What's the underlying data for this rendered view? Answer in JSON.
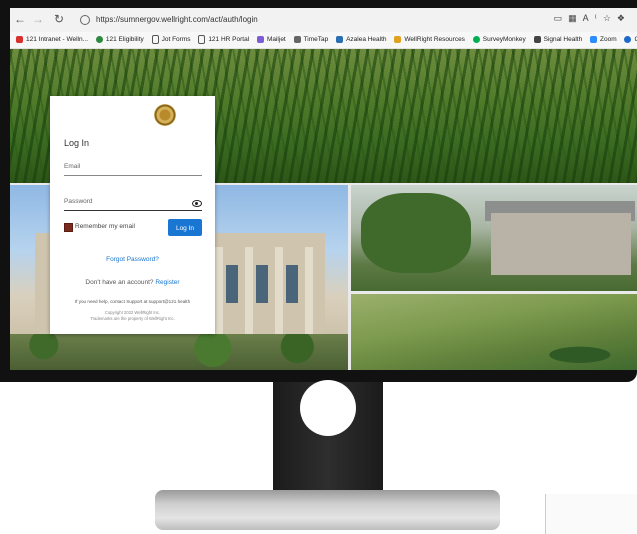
{
  "browser": {
    "url": "https://sumnergov.wellright.com/act/auth/login",
    "toolbar_icons": [
      "tab-icon",
      "grid-icon",
      "read-aloud-icon",
      "favorite-icon",
      "extensions-icon"
    ],
    "bookmarks": [
      {
        "label": "121 Intranet - Welln...",
        "color": "#d7302d"
      },
      {
        "label": "121 Eligibility",
        "color": "#2b8a3e"
      },
      {
        "label": "Jot Forms",
        "color": "#555555"
      },
      {
        "label": "121 HR Portal",
        "color": "#555555"
      },
      {
        "label": "Mailjet",
        "color": "#7d5cd6"
      },
      {
        "label": "TimeTap",
        "color": "#666666"
      },
      {
        "label": "Azalea Health",
        "color": "#2a6fb3"
      },
      {
        "label": "WellRight Resources",
        "color": "#e0a020"
      },
      {
        "label": "SurveyMonkey",
        "color": "#00b050"
      },
      {
        "label": "Signal Health",
        "color": "#444444"
      },
      {
        "label": "Zoom",
        "color": "#2d8cff"
      },
      {
        "label": "Ce",
        "color": "#1b6ac9"
      }
    ]
  },
  "login": {
    "title": "Log In",
    "email_label": "Email",
    "password_label": "Password",
    "remember_label": "Remember my email",
    "login_button": "Log In",
    "forgot_link": "Forgot Password?",
    "no_account_text": "Don't have an account?",
    "register_link": "Register",
    "help_text": "If you need help, contact Support at support@121.health",
    "copyright_line1": "Copyright 2022 WellRight Inc.",
    "copyright_line2": "Trademarks are the property of WellRight Inc."
  }
}
